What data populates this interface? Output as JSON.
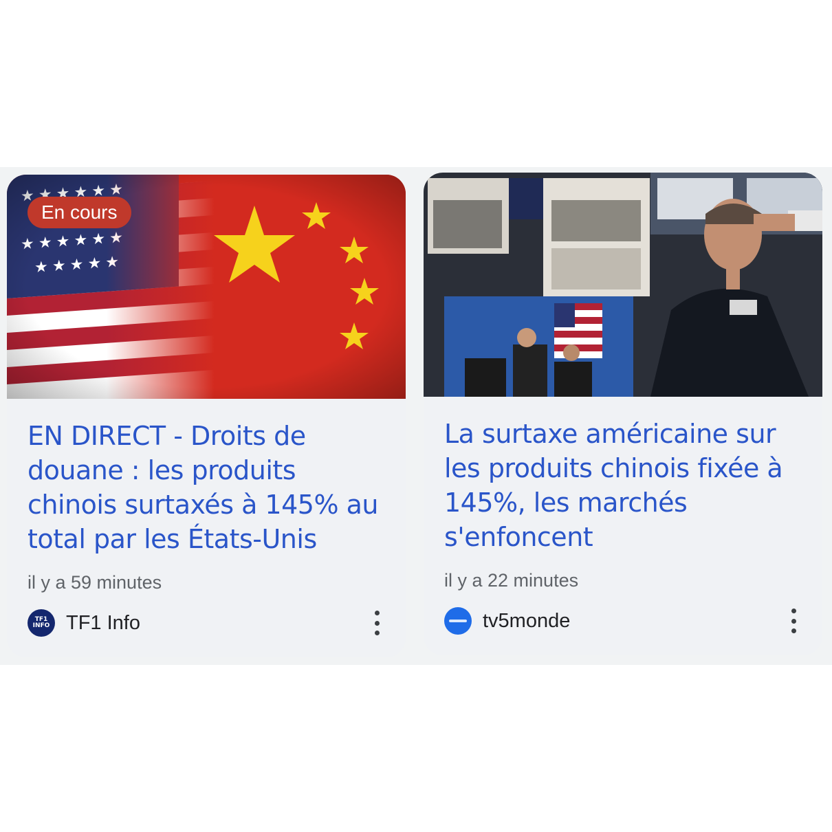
{
  "cards": [
    {
      "badge": "En cours",
      "image": "us-china-flags",
      "headline": "EN DIRECT - Droits de douane : les produits chinois surtaxés à 145% au total par les États-Unis",
      "time": "il y a 59 minutes",
      "source": "TF1 Info",
      "source_logo_text": "TF1 INFO",
      "source_logo_icon": "tf1-info-logo"
    },
    {
      "image": "trader-stock-exchange",
      "headline": "La surtaxe américaine sur les produits chinois fixée à 145%, les marchés s'enfoncent",
      "time": "il y a 22 minutes",
      "source": "tv5monde",
      "source_logo_icon": "tv5monde-logo"
    }
  ],
  "colors": {
    "headline": "#2a55c9",
    "badge": "#c0392b",
    "card_bg": "#f0f2f5"
  }
}
